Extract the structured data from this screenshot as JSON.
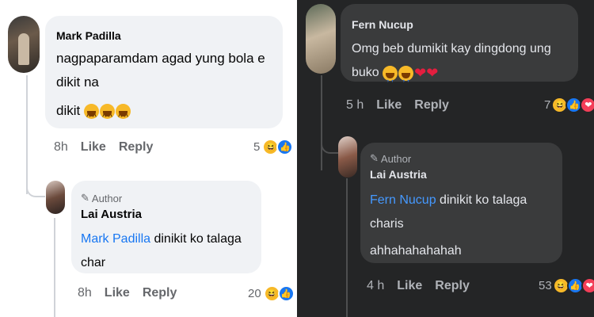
{
  "left": {
    "comment1": {
      "name": "Mark Padilla",
      "text_line1": "nagpaparamdam agad yung bola e dikit na",
      "text_line2": "dikit",
      "time": "8h",
      "like": "Like",
      "reply": "Reply",
      "reactions": "5"
    },
    "comment2": {
      "author_badge": "Author",
      "name": "Lai Austria",
      "mention": "Mark Padilla",
      "text": " dinikit ko talaga char",
      "time": "8h",
      "like": "Like",
      "reply": "Reply",
      "reactions": "20"
    }
  },
  "right": {
    "comment1": {
      "name": "Fern Nucup",
      "text": "Omg beb dumikit kay dingdong ung buko",
      "time": "5 h",
      "like": "Like",
      "reply": "Reply",
      "reactions": "7"
    },
    "comment2": {
      "author_badge": "Author",
      "name": "Lai Austria",
      "mention": "Fern Nucup",
      "text_line1": " dinikit ko talaga charis",
      "text_line2": "ahhahahahahah",
      "time": "4 h",
      "like": "Like",
      "reply": "Reply",
      "reactions": "53"
    }
  },
  "colors": {
    "like_blue": "#1877f2",
    "haha_yellow": "#f7b928",
    "love_red": "#f33e58",
    "dark_bg": "#242526",
    "dark_bubble": "#3a3b3c"
  }
}
